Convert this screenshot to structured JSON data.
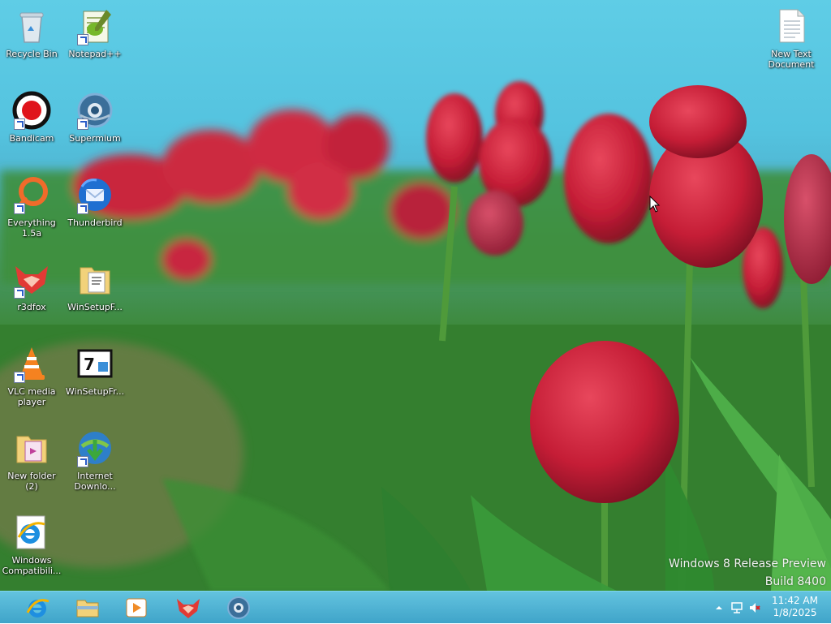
{
  "desktop_icons": [
    {
      "name": "recycle-bin",
      "label": "Recycle Bin",
      "icon": "recycle-bin-icon"
    },
    {
      "name": "notepadpp",
      "label": "Notepad++",
      "icon": "notepadpp-icon"
    },
    {
      "name": "bandicam",
      "label": "Bandicam",
      "icon": "bandicam-icon"
    },
    {
      "name": "supermium",
      "label": "Supermium",
      "icon": "supermium-icon"
    },
    {
      "name": "everything",
      "label": "Everything 1.5a",
      "icon": "everything-icon"
    },
    {
      "name": "thunderbird",
      "label": "Thunderbird",
      "icon": "thunderbird-icon"
    },
    {
      "name": "r3dfox",
      "label": "r3dfox",
      "icon": "r3dfox-icon"
    },
    {
      "name": "winsetupfolder",
      "label": "WinSetupF...",
      "icon": "folder-icon"
    },
    {
      "name": "vlc",
      "label": "VLC media player",
      "icon": "vlc-icon"
    },
    {
      "name": "winsetupfromusb",
      "label": "WinSetupFr...",
      "icon": "winsetup-icon"
    },
    {
      "name": "new-folder-2",
      "label": "New folder (2)",
      "icon": "folder-icon"
    },
    {
      "name": "internet-download-manager",
      "label": "Internet Downlo...",
      "icon": "idm-icon"
    },
    {
      "name": "windows-compatibility",
      "label": "Windows Compatibili...",
      "icon": "ie-icon"
    },
    {
      "name": "new-text-document",
      "label": "New Text Document",
      "icon": "text-document-icon"
    }
  ],
  "watermark": {
    "line1": "Windows 8 Release Preview",
    "line2": "Build 8400"
  },
  "taskbar": {
    "pinned": [
      "internet-explorer-icon",
      "file-explorer-icon",
      "media-player-icon",
      "r3dfox-icon",
      "supermium-icon"
    ],
    "tray_icons": [
      "show-hidden-icons-chevron",
      "network-icon",
      "volume-muted-icon"
    ],
    "clock_time": "11:42 AM",
    "clock_date": "1/8/2025"
  },
  "colors": {
    "sky": "#5fcde6",
    "tulip_red": "#c8213a",
    "leaf_green": "#3a8f3a",
    "taskbar": "#4fb3d6"
  }
}
